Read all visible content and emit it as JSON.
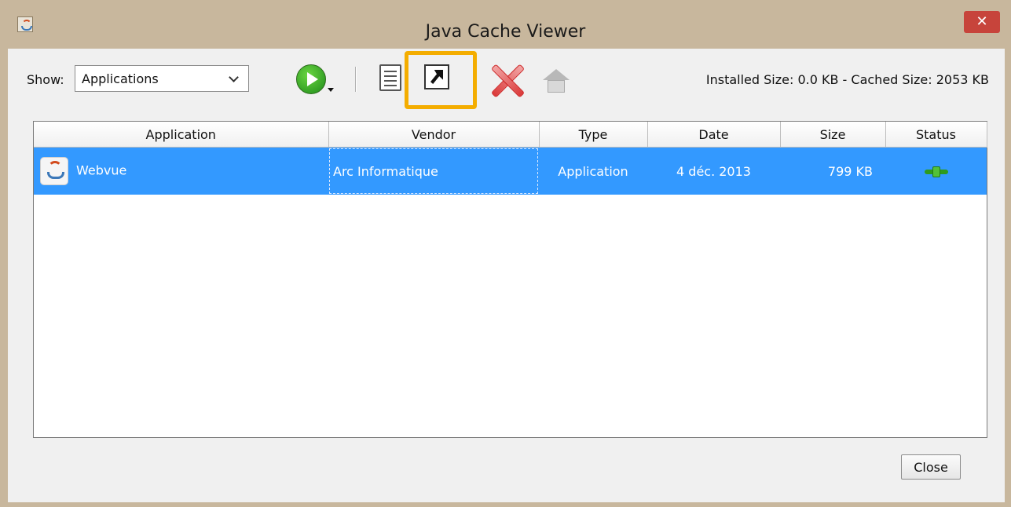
{
  "window": {
    "title": "Java Cache Viewer",
    "close_glyph": "✕"
  },
  "toolbar": {
    "show_label": "Show:",
    "show_select": {
      "value": "Applications"
    },
    "sizes_text": "Installed Size:  0.0 KB - Cached Size:  2053 KB",
    "icons": [
      "run-icon",
      "show-details-icon",
      "install-shortcut-icon",
      "delete-icon",
      "homepage-icon"
    ]
  },
  "table": {
    "columns": [
      "Application",
      "Vendor",
      "Type",
      "Date",
      "Size",
      "Status"
    ],
    "rows": [
      {
        "application": "Webvue",
        "vendor": "Arc Informatique",
        "type": "Application",
        "date": "4 déc. 2013",
        "size": "799 KB",
        "status_icon": "connected-plug-icon"
      }
    ],
    "selected_color": "#3399ff"
  },
  "footer": {
    "close_label": "Close"
  },
  "colors": {
    "highlight": "#f4ad00",
    "titlebar": "#c8b79d",
    "close_button": "#c7443b"
  }
}
